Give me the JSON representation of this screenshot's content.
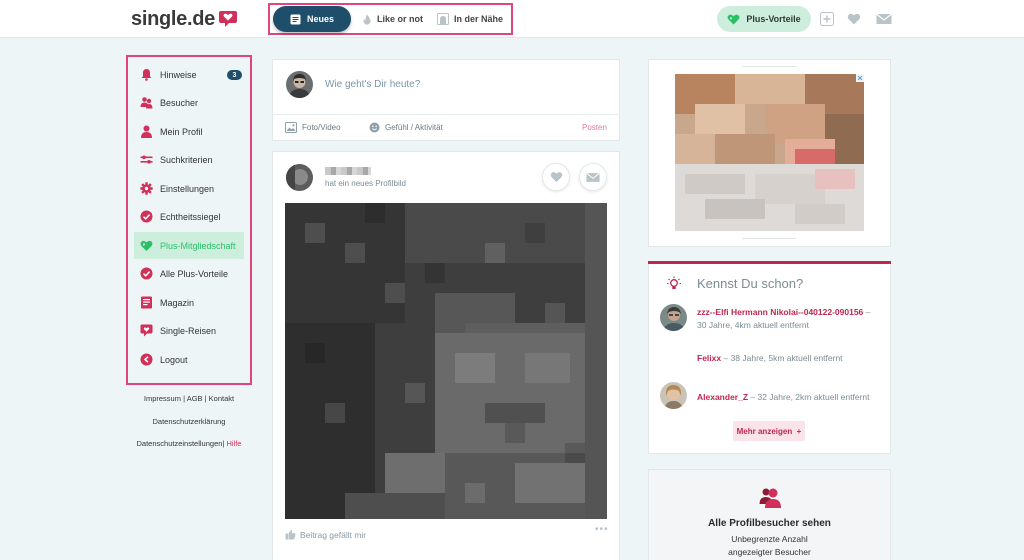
{
  "header": {
    "logo_text": "single.de",
    "nav": [
      {
        "label": "Neues",
        "icon": "news-icon"
      },
      {
        "label": "Like or not",
        "icon": "flame-icon"
      },
      {
        "label": "In der Nähe",
        "icon": "map-pin-icon"
      }
    ],
    "plus_label": "Plus-Vorteile",
    "icons": [
      "add-icon",
      "heart-icon",
      "mail-icon"
    ]
  },
  "sidebar": {
    "items": [
      {
        "label": "Hinweise",
        "icon": "bell-icon",
        "badge": "3"
      },
      {
        "label": "Besucher",
        "icon": "visitors-icon"
      },
      {
        "label": "Mein Profil",
        "icon": "user-icon"
      },
      {
        "label": "Suchkriterien",
        "icon": "sliders-icon"
      },
      {
        "label": "Einstellungen",
        "icon": "gear-icon"
      },
      {
        "label": "Echtheitssiegel",
        "icon": "check-badge-icon"
      },
      {
        "label": "Plus-Mitgliedschaft",
        "icon": "plus-heart-icon",
        "active": true
      },
      {
        "label": "Alle Plus-Vorteile",
        "icon": "check-badge-icon"
      },
      {
        "label": "Magazin",
        "icon": "magazine-icon"
      },
      {
        "label": "Single-Reisen",
        "icon": "travel-heart-icon"
      },
      {
        "label": "Logout",
        "icon": "logout-icon"
      }
    ],
    "footer": {
      "impressum": "Impressum",
      "agb": "AGB",
      "kontakt": "Kontakt",
      "datenschutz": "Datenschutzerklärung",
      "datenschutz_settings": "Datenschutzeinstellungen",
      "hilfe": "Hilfe"
    }
  },
  "compose": {
    "placeholder": "Wie geht's Dir heute?",
    "photo_video": "Foto/Video",
    "feeling": "Gefühl / Aktivität",
    "post": "Posten"
  },
  "feed_post": {
    "subtitle": "hat ein neues Profilbild",
    "like_label": "Beitrag gefällt mir",
    "more": "•••"
  },
  "kennst_du_schon": {
    "title": "Kennst Du schon?",
    "people": [
      {
        "name": "zzz--Elfi Hermann Nikolai--040122-090156",
        "details": "30 Jahre, 4km aktuell entfernt"
      },
      {
        "name": "Felixx",
        "details": "38 Jahre, 5km aktuell entfernt"
      },
      {
        "name": "Alexander_Z",
        "details": "32 Jahre, 2km aktuell entfernt"
      }
    ],
    "more_label": "Mehr anzeigen",
    "more_suffix": "+"
  },
  "visitors_promo": {
    "title": "Alle Profilbesucher sehen",
    "line1": "Unbegrenzte Anzahl",
    "line2": "angezeigter Besucher"
  },
  "colors": {
    "brand_red": "#c0264f",
    "nav_active": "#1f4e6b",
    "plus_green": "#cdeedd",
    "highlight_frame": "#e0457b"
  }
}
